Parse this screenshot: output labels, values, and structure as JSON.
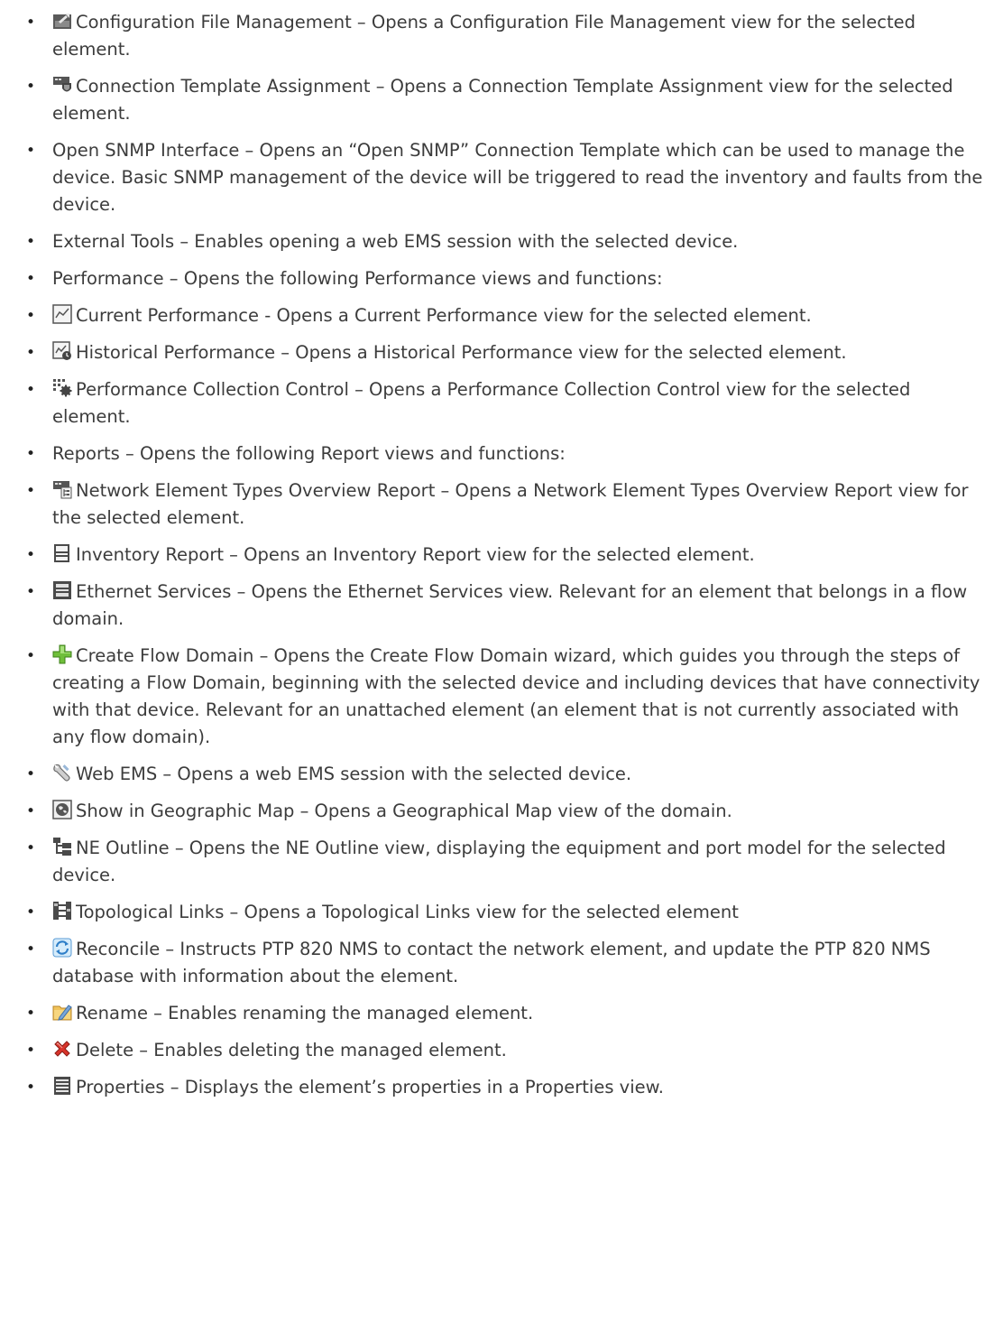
{
  "items": [
    {
      "icon": "config-file-icon",
      "text": "Configuration File Management – Opens a Configuration File Management view for the selected element."
    },
    {
      "icon": "connection-template-icon",
      "text": "Connection Template Assignment – Opens a Connection Template Assignment view for the selected element."
    },
    {
      "icon": "",
      "text": "Open SNMP Interface – Opens an “Open SNMP” Connection Template which can be used to manage the device. Basic SNMP management of the device will be triggered to read the inventory and faults from the device."
    },
    {
      "icon": "",
      "text": "External Tools – Enables opening a web EMS session with the selected device."
    },
    {
      "icon": "",
      "text": "Performance – Opens the following Performance views and functions:"
    },
    {
      "icon": "current-performance-icon",
      "text": "Current Performance - Opens a Current Performance view for the selected element."
    },
    {
      "icon": "historical-performance-icon",
      "text": "Historical Performance – Opens a Historical Performance view for the selected element."
    },
    {
      "icon": "performance-collection-icon",
      "text": "Performance Collection Control – Opens a Performance Collection Control view for the selected element."
    },
    {
      "icon": "",
      "text": "Reports – Opens the following Report views and functions:"
    },
    {
      "icon": "ne-types-report-icon",
      "text": "Network Element Types Overview Report – Opens a Network Element Types Overview Report view for the selected element."
    },
    {
      "icon": "inventory-report-icon",
      "text": "Inventory Report – Opens an Inventory Report view for the selected element."
    },
    {
      "icon": "ethernet-services-icon",
      "text": "Ethernet Services – Opens the Ethernet Services view. Relevant for an element that belongs in a flow domain."
    },
    {
      "icon": "create-flow-domain-icon",
      "text": "Create Flow Domain – Opens the Create Flow Domain wizard, which guides you through the steps of creating a Flow Domain, beginning with the selected device and including devices that have connectivity with that device. Relevant for an unattached element (an element that is not currently associated with any flow domain)."
    },
    {
      "icon": "wrench-icon",
      "text": "Web EMS – Opens a web EMS session with the selected device."
    },
    {
      "icon": "globe-icon",
      "text": "Show in Geographic Map – Opens a Geographical Map view of the domain."
    },
    {
      "icon": "ne-outline-icon",
      "text": "NE Outline – Opens the NE Outline view, displaying the equipment and port model for the selected device."
    },
    {
      "icon": "topological-links-icon",
      "text": "Topological Links – Opens a Topological Links view for the selected element"
    },
    {
      "icon": "reconcile-icon",
      "text": "Reconcile – Instructs PTP 820 NMS to contact the network element, and update the PTP 820 NMS database with information about the element."
    },
    {
      "icon": "rename-icon",
      "text": "Rename – Enables renaming the managed element."
    },
    {
      "icon": "delete-icon",
      "text": "Delete – Enables deleting the managed element."
    },
    {
      "icon": "properties-icon",
      "text": "Properties – Displays the element’s properties in a Properties view."
    }
  ]
}
